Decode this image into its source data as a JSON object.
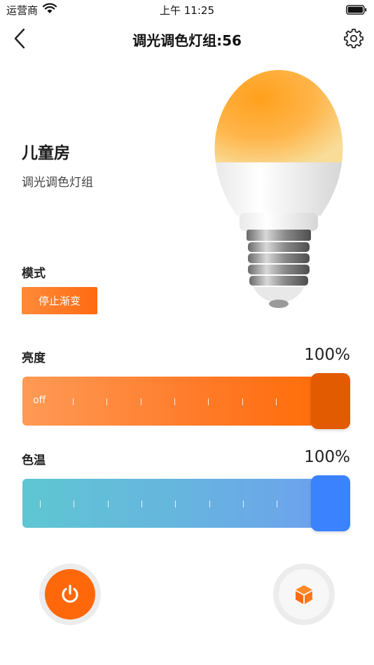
{
  "status_bar": {
    "carrier": "运营商",
    "time": "上午 11:25"
  },
  "nav": {
    "title": "调光调色灯组:56"
  },
  "device": {
    "room": "儿童房",
    "type": "调光调色灯组"
  },
  "mode": {
    "label": "模式",
    "button": "停止渐变"
  },
  "brightness": {
    "label": "亮度",
    "value_text": "100%",
    "value": 100,
    "off_label": "off",
    "tick_count": 8
  },
  "color_temp": {
    "label": "色温",
    "value_text": "100%",
    "value": 100,
    "tick_count": 8
  },
  "colors": {
    "accent": "#ff680a",
    "brightness_knob": "#e25b00",
    "temp_knob": "#3b82ff"
  },
  "icons": {
    "back": "chevron-left-icon",
    "settings": "gear-icon",
    "power": "power-icon",
    "scene": "cube-icon"
  }
}
